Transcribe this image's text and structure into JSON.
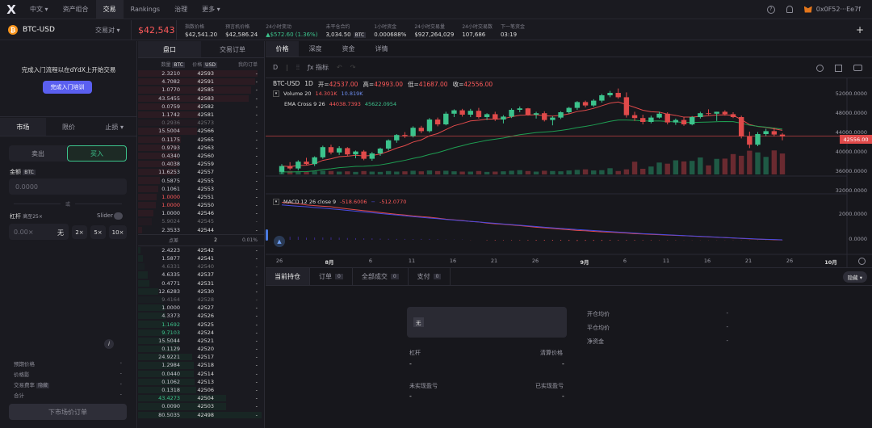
{
  "nav": {
    "logo": "X",
    "lang": "中文",
    "items": [
      "资产组合",
      "交易",
      "Rankings",
      "治理",
      "更多"
    ],
    "active": 1,
    "help_icon": "?",
    "wallet": "0x0F52···Ee7f"
  },
  "market": {
    "symbol": "BTC-USD",
    "pair_selector": "交易对",
    "price": "$42,543",
    "stats": [
      {
        "label": "指数价格",
        "value": "$42,541.20"
      },
      {
        "label": "预言机价格",
        "value": "$42,586.24"
      },
      {
        "label": "24小时变动",
        "value": "▲$572.60 (1.36%)"
      },
      {
        "label": "未平仓合约",
        "value": "3,034.50",
        "tag": "BTC"
      },
      {
        "label": "1小时资金",
        "value": "0.000688%"
      },
      {
        "label": "24小时交易量",
        "value": "$927,264,029"
      },
      {
        "label": "24小时交易数",
        "value": "107,686"
      },
      {
        "label": "下一笔资金",
        "value": "03:19"
      }
    ],
    "plus": "+"
  },
  "left": {
    "onboarding_text": "完成入门流程以在dYdX上开始交易",
    "onboarding_button": "完成入门培训",
    "order_tabs": [
      "市场",
      "限价",
      "止损"
    ],
    "sell": "卖出",
    "buy": "买入",
    "amount_label": "金额",
    "amount_tag": "BTC",
    "amount_placeholder": "0.0000",
    "or": "或",
    "leverage_label": "杠杆",
    "leverage_max": "高至25×",
    "slider_label": "Slider",
    "leverage_value": "0.00×",
    "leverage_none": "无",
    "leverage_buttons": [
      "2×",
      "5×",
      "10×"
    ],
    "info": "i",
    "summary": [
      {
        "label": "预期价格",
        "value": "-"
      },
      {
        "label": "价格影",
        "value": "-"
      },
      {
        "label": "交易费率",
        "tag": "隐藏",
        "value": "-"
      },
      {
        "label": "合计",
        "value": "-"
      }
    ],
    "submit": "下市场价订单"
  },
  "orderbook": {
    "tabs": [
      "盘口",
      "交易订单"
    ],
    "headers": {
      "size": "数量",
      "size_tag": "BTC",
      "price": "价格",
      "price_tag": "USD",
      "mine": "我的订单"
    },
    "asks": [
      {
        "size": "2.3210",
        "price": "42593",
        "mine": "-",
        "depth": 0.95
      },
      {
        "size": "4.7082",
        "price": "42591",
        "mine": "-",
        "depth": 0.93
      },
      {
        "size": "1.0770",
        "price": "42585",
        "mine": "-",
        "depth": 0.9
      },
      {
        "size": "43.5455",
        "price": "42583",
        "mine": "-",
        "depth": 0.88
      },
      {
        "size": "0.0759",
        "price": "42582",
        "mine": "-",
        "depth": 0.5
      },
      {
        "size": "1.1742",
        "price": "42581",
        "mine": "-",
        "depth": 0.49
      },
      {
        "size": "0.2936",
        "price": "42573",
        "mine": "-",
        "depth": 0.48,
        "dim": true
      },
      {
        "size": "15.5004",
        "price": "42566",
        "mine": "-",
        "depth": 0.47
      },
      {
        "size": "0.1175",
        "price": "42565",
        "mine": "-",
        "depth": 0.34
      },
      {
        "size": "0.9793",
        "price": "42563",
        "mine": "-",
        "depth": 0.33
      },
      {
        "size": "0.4340",
        "price": "42560",
        "mine": "-",
        "depth": 0.32
      },
      {
        "size": "0.4038",
        "price": "42559",
        "mine": "-",
        "depth": 0.32
      },
      {
        "size": "11.6253",
        "price": "42557",
        "mine": "-",
        "depth": 0.31
      },
      {
        "size": "0.5875",
        "price": "42555",
        "mine": "-",
        "depth": 0.17
      },
      {
        "size": "0.1061",
        "price": "42553",
        "mine": "-",
        "depth": 0.16
      },
      {
        "size": "1.0000",
        "price": "42551",
        "mine": "-",
        "depth": 0.15,
        "red": true
      },
      {
        "size": "1.0000",
        "price": "42550",
        "mine": "-",
        "depth": 0.14,
        "red": true
      },
      {
        "size": "1.0000",
        "price": "42546",
        "mine": "-",
        "depth": 0.12
      },
      {
        "size": "5.9024",
        "price": "42545",
        "mine": "-",
        "depth": 0.11,
        "dim": true
      },
      {
        "size": "2.3533",
        "price": "42544",
        "mine": "-",
        "depth": 0.03
      }
    ],
    "spread_label": "点差",
    "spread_value": "2",
    "spread_pct": "0.01%",
    "bids": [
      {
        "size": "2.4223",
        "price": "42542",
        "mine": "-",
        "depth": 0.02
      },
      {
        "size": "1.5877",
        "price": "42541",
        "mine": "-",
        "depth": 0.04
      },
      {
        "size": "4.6331",
        "price": "42540",
        "mine": "-",
        "depth": 0.05,
        "dim": true
      },
      {
        "size": "4.6335",
        "price": "42537",
        "mine": "-",
        "depth": 0.08
      },
      {
        "size": "0.4771",
        "price": "42531",
        "mine": "-",
        "depth": 0.09
      },
      {
        "size": "12.6283",
        "price": "42530",
        "mine": "-",
        "depth": 0.16
      },
      {
        "size": "9.4164",
        "price": "42528",
        "mine": "-",
        "depth": 0.2,
        "dim": true
      },
      {
        "size": "1.0000",
        "price": "42527",
        "mine": "-",
        "depth": 0.21
      },
      {
        "size": "4.3373",
        "price": "42526",
        "mine": "-",
        "depth": 0.22
      },
      {
        "size": "1.1692",
        "price": "42525",
        "mine": "-",
        "depth": 0.23,
        "green": true
      },
      {
        "size": "9.7103",
        "price": "42524",
        "mine": "-",
        "depth": 0.26,
        "green": true
      },
      {
        "size": "15.5044",
        "price": "42521",
        "mine": "-",
        "depth": 0.32
      },
      {
        "size": "0.1129",
        "price": "42520",
        "mine": "-",
        "depth": 0.33
      },
      {
        "size": "24.9221",
        "price": "42517",
        "mine": "-",
        "depth": 0.43
      },
      {
        "size": "1.2984",
        "price": "42518",
        "mine": "-",
        "depth": 0.44
      },
      {
        "size": "0.0440",
        "price": "42514",
        "mine": "-",
        "depth": 0.44
      },
      {
        "size": "0.1062",
        "price": "42513",
        "mine": "-",
        "depth": 0.45
      },
      {
        "size": "0.1318",
        "price": "42506",
        "mine": "-",
        "depth": 0.46
      },
      {
        "size": "43.4273",
        "price": "42504",
        "mine": "-",
        "depth": 0.7,
        "green": true
      },
      {
        "size": "0.0090",
        "price": "42503",
        "mine": "-",
        "depth": 0.7
      },
      {
        "size": "80.5035",
        "price": "42498",
        "mine": "-",
        "depth": 0.98
      }
    ]
  },
  "chart": {
    "tabs": [
      "价格",
      "深度",
      "资金",
      "详情"
    ],
    "toolbar": {
      "interval": "D",
      "indicators": "指标"
    },
    "ohlc": {
      "symbol": "BTC-USD",
      "interval": "1D",
      "o_label": "开=",
      "o": "42537.00",
      "h_label": "高=",
      "h": "42993.00",
      "l_label": "低=",
      "l": "41687.00",
      "c_label": "收=",
      "c": "42556.00"
    },
    "volume_label": "Volume 20",
    "volume_v1": "14.301K",
    "volume_v2": "10.819K",
    "ema_label": "EMA Cross 9 26",
    "ema_v1": "44038.7393",
    "ema_v2": "45622.0954",
    "macd_label": "MACD 12 26 close 9",
    "macd_v1": "-518.6006",
    "macd_v2": "−",
    "macd_v3": "-512.0770",
    "y_labels": [
      "52000.0000",
      "48000.0000",
      "44000.0000",
      "40000.0000",
      "36000.0000",
      "32000.0000"
    ],
    "price_tag": "42556.00",
    "macd_y": [
      "2000.0000",
      "0.0000"
    ],
    "x_labels": [
      "26",
      "8月",
      "6",
      "11",
      "16",
      "21",
      "26",
      "9月",
      "6",
      "11",
      "16",
      "21",
      "26",
      "10月"
    ],
    "colors": {
      "up": "#3cc38c",
      "down": "#e04a4a",
      "ema_fast": "#e04a4a",
      "ema_slow": "#1e9e52",
      "macd": "#e04a4a",
      "signal": "#4a4ae0"
    }
  },
  "chart_data": {
    "type": "candlestick",
    "ylim": [
      30000,
      56000
    ],
    "ticks": [
      52000,
      48000,
      44000,
      40000,
      36000,
      32000
    ],
    "candles": [
      [
        35200,
        36800,
        34800,
        36400
      ],
      [
        36400,
        37200,
        35600,
        35900
      ],
      [
        35900,
        37600,
        35500,
        37300
      ],
      [
        37300,
        38100,
        36600,
        36800
      ],
      [
        36800,
        38400,
        36400,
        38200
      ],
      [
        38200,
        40600,
        37900,
        40300
      ],
      [
        40300,
        40800,
        38800,
        39200
      ],
      [
        39200,
        40500,
        38700,
        40100
      ],
      [
        40100,
        40300,
        38500,
        38800
      ],
      [
        38800,
        39600,
        38000,
        39400
      ],
      [
        39400,
        39700,
        37600,
        37900
      ],
      [
        37900,
        39300,
        37500,
        39000
      ],
      [
        39000,
        40200,
        38500,
        40000
      ],
      [
        40000,
        41900,
        39600,
        41700
      ],
      [
        41700,
        43000,
        41200,
        42800
      ],
      [
        42800,
        43400,
        42200,
        42600
      ],
      [
        42600,
        44600,
        42300,
        44300
      ],
      [
        44300,
        44700,
        43200,
        43600
      ],
      [
        43600,
        46300,
        43300,
        46000
      ],
      [
        46000,
        46400,
        44600,
        45000
      ],
      [
        45000,
        47600,
        44800,
        47200
      ],
      [
        47200,
        48100,
        46500,
        47900
      ],
      [
        47900,
        48200,
        46600,
        47000
      ],
      [
        47000,
        48200,
        46500,
        47800
      ],
      [
        47800,
        48400,
        46200,
        46500
      ],
      [
        46500,
        47300,
        45900,
        47100
      ],
      [
        47100,
        47600,
        45700,
        46000
      ],
      [
        46000,
        46900,
        45200,
        46600
      ],
      [
        46600,
        48300,
        46300,
        48000
      ],
      [
        48000,
        48700,
        47500,
        48300
      ],
      [
        48300,
        48400,
        46800,
        47000
      ],
      [
        47000,
        47600,
        46200,
        47300
      ],
      [
        47300,
        47700,
        45600,
        45900
      ],
      [
        45900,
        46700,
        44800,
        46400
      ],
      [
        46400,
        47700,
        46100,
        47500
      ],
      [
        47500,
        48600,
        47200,
        48400
      ],
      [
        48400,
        49800,
        48000,
        49600
      ],
      [
        49600,
        49900,
        48500,
        48900
      ],
      [
        48900,
        50200,
        48600,
        49900
      ],
      [
        49900,
        51300,
        49500,
        51000
      ],
      [
        51000,
        51900,
        50600,
        51500
      ],
      [
        51500,
        52400,
        50300,
        50600
      ],
      [
        50600,
        51600,
        46400,
        46900
      ],
      [
        46900,
        47600,
        45700,
        46300
      ],
      [
        46300,
        47000,
        45000,
        45500
      ],
      [
        45500,
        46800,
        45200,
        46400
      ],
      [
        46400,
        47600,
        46200,
        47200
      ],
      [
        47200,
        47500,
        45000,
        45400
      ],
      [
        45400,
        46200,
        44900,
        45900
      ],
      [
        45900,
        46500,
        44700,
        45000
      ],
      [
        45000,
        46700,
        44800,
        46500
      ],
      [
        46500,
        47600,
        46200,
        47300
      ],
      [
        47300,
        48100,
        46900,
        47200
      ],
      [
        47200,
        47600,
        45700,
        47600
      ],
      [
        47600,
        47900,
        46800,
        47100
      ],
      [
        47100,
        47500,
        46300,
        46500
      ],
      [
        46500,
        46800,
        42100,
        42500
      ],
      [
        42500,
        43500,
        40100,
        40800
      ],
      [
        40800,
        43400,
        40500,
        43000
      ],
      [
        43000,
        44100,
        42600,
        43600
      ],
      [
        43600,
        44300,
        42500,
        42900
      ],
      [
        42900,
        43200,
        41700,
        42556
      ]
    ],
    "volumes": [
      0.1,
      0.12,
      0.1,
      0.09,
      0.11,
      0.13,
      0.12,
      0.1,
      0.11,
      0.09,
      0.12,
      0.1,
      0.09,
      0.12,
      0.1,
      0.11,
      0.13,
      0.11,
      0.14,
      0.12,
      0.13,
      0.11,
      0.1,
      0.1,
      0.12,
      0.09,
      0.1,
      0.11,
      0.13,
      0.15,
      0.12,
      0.1,
      0.13,
      0.12,
      0.11,
      0.14,
      0.16,
      0.18,
      0.14,
      0.15,
      0.22,
      0.12,
      0.18,
      0.45,
      0.2,
      0.28,
      0.42,
      0.38,
      0.5,
      0.46,
      0.48,
      0.6,
      0.32,
      0.55,
      0.56,
      0.72,
      0.66,
      0.84,
      0.78,
      0.62,
      0.85,
      0.74
    ],
    "macd": [
      2900,
      2850,
      2800,
      2700,
      2650,
      2600,
      2560,
      2480,
      2400,
      2330,
      2260,
      2200,
      2120,
      2050,
      1980,
      1920,
      1850,
      1800,
      1750,
      1680,
      1600,
      1550,
      1500,
      1420,
      1380,
      1300,
      1240,
      1200,
      1150,
      1100,
      1040,
      980,
      930,
      880,
      830,
      780,
      730,
      700,
      660,
      620,
      590,
      560,
      520,
      480,
      450,
      420,
      400,
      370,
      340,
      320,
      290,
      260,
      230,
      200,
      170,
      140,
      110,
      80,
      50,
      30,
      10,
      -10
    ],
    "signal": [
      2700,
      2650,
      2600,
      2560,
      2500,
      2450,
      2400,
      2340,
      2280,
      2220,
      2160,
      2100,
      2040,
      1980,
      1920,
      1860,
      1800,
      1740,
      1690,
      1640,
      1580,
      1530,
      1480,
      1430,
      1380,
      1330,
      1280,
      1230,
      1180,
      1130,
      1080,
      1030,
      980,
      930,
      880,
      840,
      800,
      760,
      720,
      680,
      640,
      600,
      560,
      520,
      480,
      450,
      420,
      390,
      360,
      330,
      300,
      270,
      240,
      210,
      180,
      150,
      120,
      90,
      60,
      40,
      20,
      0
    ]
  },
  "positions": {
    "tabs": [
      {
        "label": "当前持仓",
        "count": ""
      },
      {
        "label": "订单",
        "count": "0"
      },
      {
        "label": "全部成交",
        "count": "0"
      },
      {
        "label": "支付",
        "count": "0"
      }
    ],
    "hide": "隐藏",
    "card_tag": "无",
    "leverage_label": "杠杆",
    "leverage_value": "-",
    "liq_label": "清算价格",
    "liq_value": "-",
    "unreal_label": "未实现盈亏",
    "unreal_value": "-",
    "real_label": "已实现盈亏",
    "real_value": "-",
    "right": [
      {
        "label": "开仓均价",
        "value": "-"
      },
      {
        "label": "平仓均价",
        "value": "-"
      },
      {
        "label": "净资金",
        "value": "-"
      }
    ]
  }
}
